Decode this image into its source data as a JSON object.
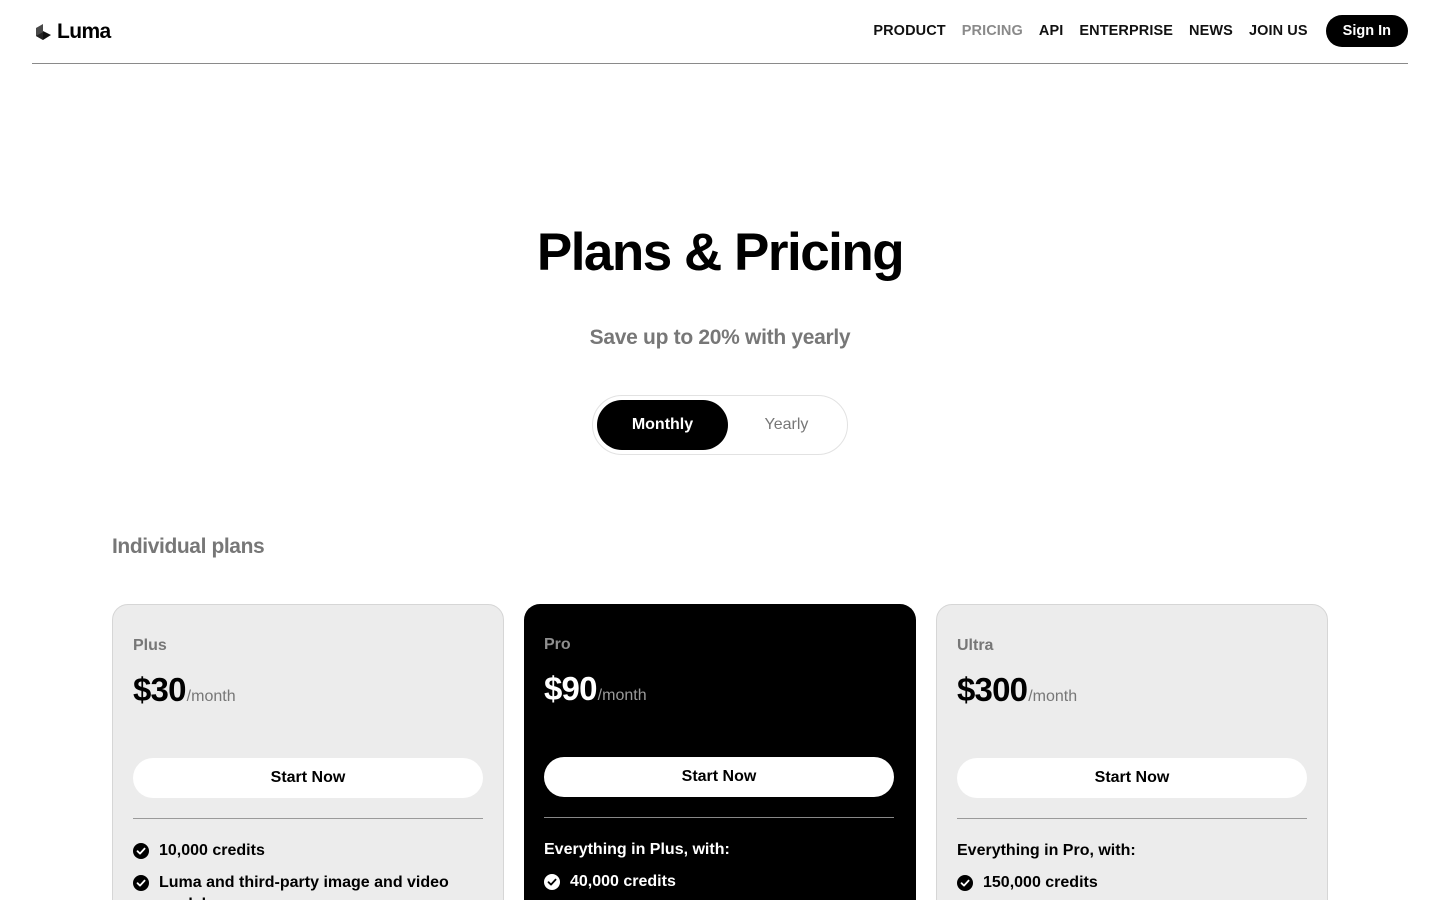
{
  "header": {
    "logo_text": "Luma",
    "nav": [
      "PRODUCT",
      "PRICING",
      "API",
      "ENTERPRISE",
      "NEWS",
      "JOIN US"
    ],
    "active_nav": "PRICING",
    "sign_in_label": "Sign In"
  },
  "hero": {
    "title": "Plans & Pricing",
    "subtitle": "Save up to 20% with yearly"
  },
  "billing_toggle": {
    "options": [
      "Monthly",
      "Yearly"
    ],
    "selected": "Monthly"
  },
  "section_label": "Individual plans",
  "plans": [
    {
      "name": "Plus",
      "price": "$30",
      "period": "/month",
      "cta": "Start Now",
      "intro": "",
      "features": [
        "10,000 credits",
        "Luma and third-party image and video models"
      ]
    },
    {
      "name": "Pro",
      "price": "$90",
      "period": "/month",
      "cta": "Start Now",
      "intro": "Everything in Plus, with:",
      "features": [
        "40,000 credits"
      ]
    },
    {
      "name": "Ultra",
      "price": "$300",
      "period": "/month",
      "cta": "Start Now",
      "intro": "Everything in Pro, with:",
      "features": [
        "150,000 credits"
      ]
    }
  ],
  "colors": {
    "accent": "#000000",
    "muted_text": "#777777",
    "card_light": "#ececec",
    "card_dark": "#000000"
  },
  "icons": [
    "luma-logo-icon",
    "check-circle-icon"
  ]
}
